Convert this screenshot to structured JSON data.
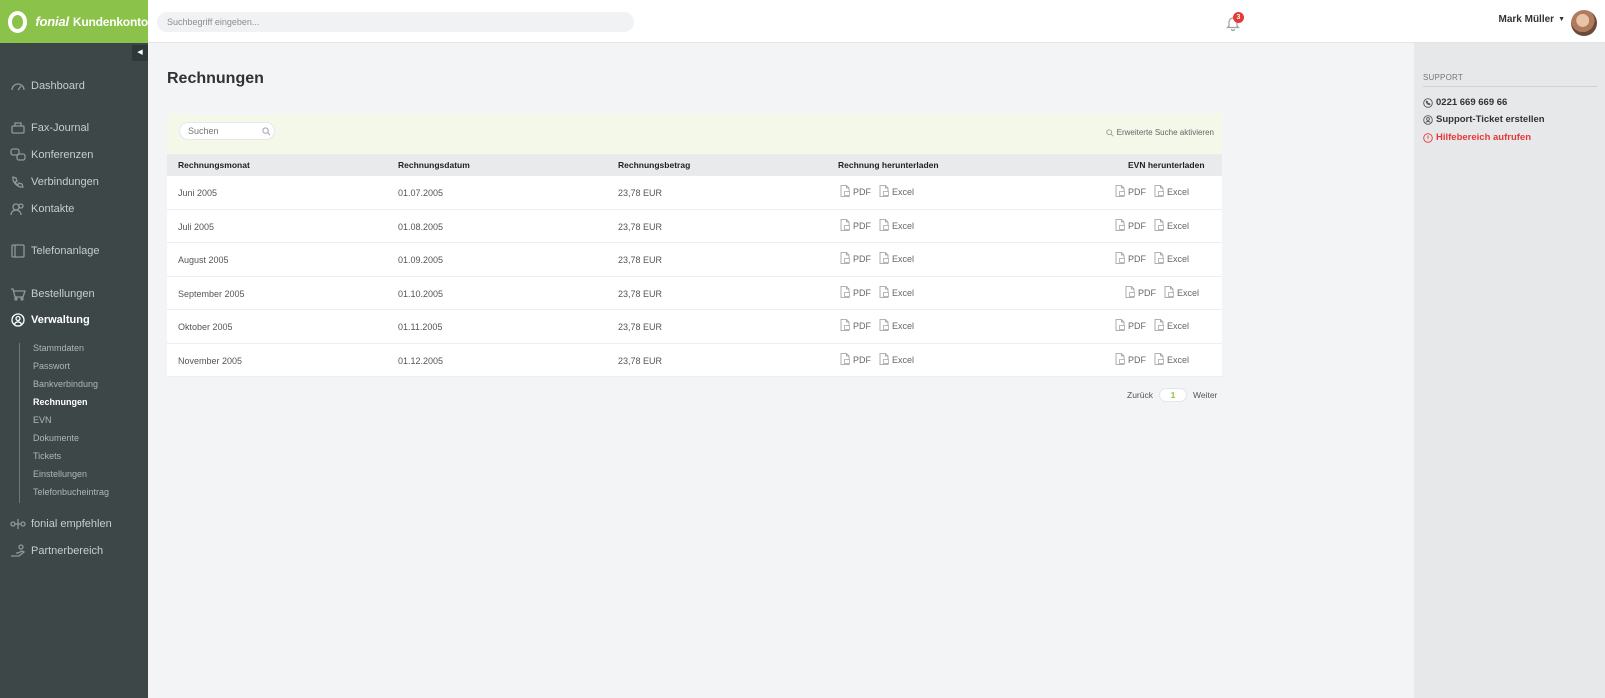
{
  "brand": {
    "name": "fonial",
    "product": "Kundenkonto",
    "accent": "#8bc34a"
  },
  "topbar": {
    "search_placeholder": "Suchbegriff eingeben...",
    "notifications": "3",
    "user_name": "Mark Müller"
  },
  "sidebar": {
    "items": [
      {
        "label": "Dashboard",
        "icon": "dashboard-icon"
      },
      {
        "label": "Fax-Journal",
        "icon": "fax-icon"
      },
      {
        "label": "Konferenzen",
        "icon": "conference-icon"
      },
      {
        "label": "Verbindungen",
        "icon": "phone-icon"
      },
      {
        "label": "Kontakte",
        "icon": "contacts-icon"
      },
      {
        "label": "Telefonanlage",
        "icon": "pbx-icon"
      },
      {
        "label": "Bestellungen",
        "icon": "cart-icon"
      },
      {
        "label": "Verwaltung",
        "icon": "user-icon"
      },
      {
        "label": "fonial empfehlen",
        "icon": "recommend-icon"
      },
      {
        "label": "Partnerbereich",
        "icon": "partner-icon"
      }
    ],
    "subitems": [
      "Stammdaten",
      "Passwort",
      "Bankverbindung",
      "Rechnungen",
      "EVN",
      "Dokumente",
      "Tickets",
      "Einstellungen",
      "Telefonbucheintrag"
    ]
  },
  "main": {
    "title": "Rechnungen",
    "search_placeholder": "Suchen",
    "advanced_search": "Erweiterte Suche aktivieren",
    "columns": [
      "Rechnungsmonat",
      "Rechnungsdatum",
      "Rechnungsbetrag",
      "Rechnung herunterladen",
      "EVN herunterladen"
    ],
    "rows": [
      {
        "month": "Juni 2005",
        "date": "01.07.2005",
        "amount": "23,78 EUR"
      },
      {
        "month": "Juli 2005",
        "date": "01.08.2005",
        "amount": "23,78 EUR"
      },
      {
        "month": "August 2005",
        "date": "01.09.2005",
        "amount": "23,78 EUR"
      },
      {
        "month": "September 2005",
        "date": "01.10.2005",
        "amount": "23,78 EUR"
      },
      {
        "month": "Oktober 2005",
        "date": "01.11.2005",
        "amount": "23,78 EUR"
      },
      {
        "month": "November 2005",
        "date": "01.12.2005",
        "amount": "23,78 EUR"
      }
    ],
    "pdf_label": "PDF",
    "excel_label": "Excel",
    "pager": {
      "prev": "Zurück",
      "page": "1",
      "next": "Weiter"
    }
  },
  "support": {
    "heading": "SUPPORT",
    "phone": "0221 669 669 66",
    "ticket": "Support-Ticket erstellen",
    "help": "Hilfebereich aufrufen",
    "help_color": "#e53935"
  }
}
